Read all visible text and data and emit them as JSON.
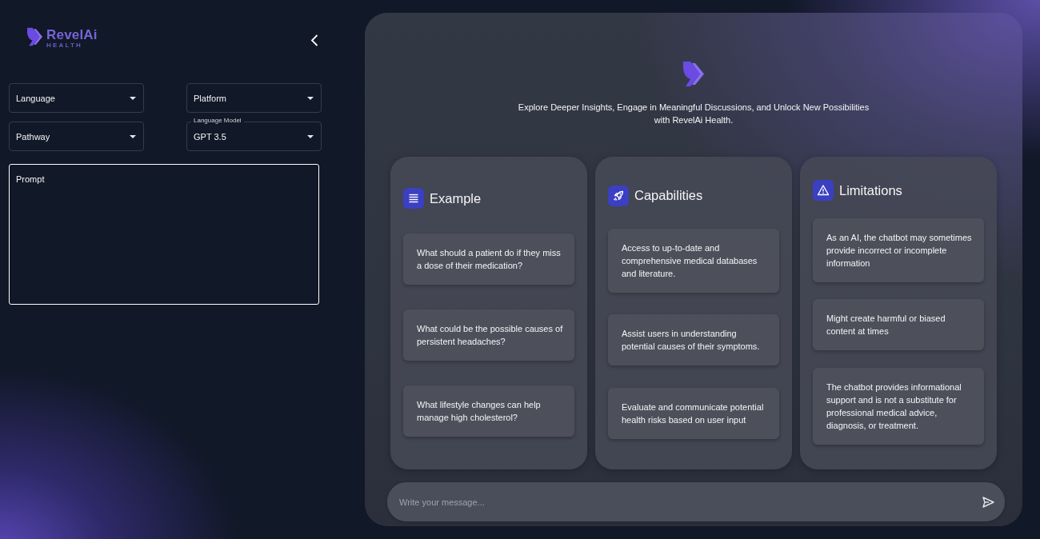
{
  "sidebar": {
    "brand": {
      "name": "RevelAi",
      "tagline": "HEALTH"
    },
    "dropdowns": [
      {
        "label": "Language"
      },
      {
        "label": "Pathway"
      },
      {
        "label": "Platform"
      },
      {
        "label": "Language Model",
        "value": "GPT 3.5"
      }
    ],
    "prompt": {
      "placeholder": "Prompt",
      "focused": true
    }
  },
  "main": {
    "intro": "Explore Deeper Insights, Engage in Meaningful Discussions, and Unlock New Possibilities with RevelAi Health.",
    "columns": [
      {
        "title": "Example",
        "items": [
          "What should a patient do if they miss a dose of their medication?",
          "What could be the possible causes of persistent headaches?",
          "What lifestyle changes can help manage high cholesterol?"
        ]
      },
      {
        "title": "Capabilities",
        "items": [
          "Access to up-to-date and comprehensive medical databases and literature.",
          "Assist users in understanding potential causes of their symptoms.",
          "Evaluate and communicate potential health risks based on user input"
        ]
      },
      {
        "title": "Limitations",
        "items": [
          "As an AI, the chatbot may sometimes provide incorrect or incomplete information",
          "Might create harmful or biased content at times",
          "The chatbot provides informational support and is not a substitute for professional medical advice, diagnosis, or treatment."
        ]
      }
    ],
    "composer": {
      "placeholder": "Write your message..."
    }
  }
}
